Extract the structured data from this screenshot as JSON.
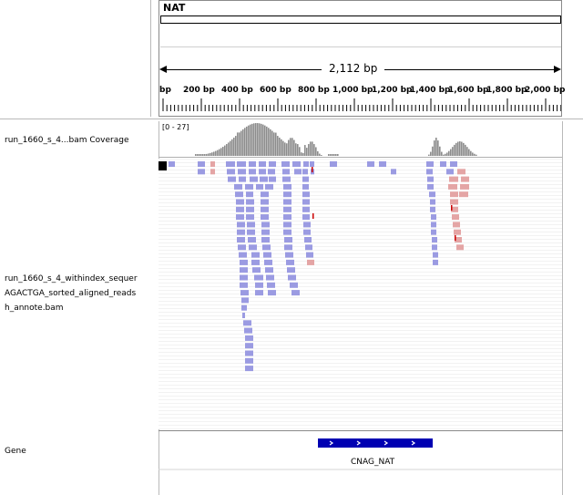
{
  "locus": {
    "name": "NAT",
    "span_label": "2,112 bp",
    "ticks": [
      "bp",
      "200 bp",
      "400 bp",
      "600 bp",
      "800 bp",
      "1,000 bp",
      "1,200 bp",
      "1,400 bp",
      "1,600 bp",
      "1,800 bp",
      "2,000 bp"
    ]
  },
  "tracks": {
    "coverage_name": "run_1660_s_4...bam Coverage",
    "coverage_range": "[0 - 27]",
    "alignment_name_lines": [
      "run_1660_s_4_withindex_sequer",
      "AGACTGA_sorted_aligned_reads",
      "h_annote.bam"
    ],
    "gene_name": "Gene",
    "gene_label": "CNAG_NAT"
  },
  "colors": {
    "forward_read": "#9b9be2",
    "reverse_read": "#e4a5a5",
    "coverage": "#8c8c8c",
    "gene": "#0000b2",
    "mismatch": "#cc0000"
  }
}
